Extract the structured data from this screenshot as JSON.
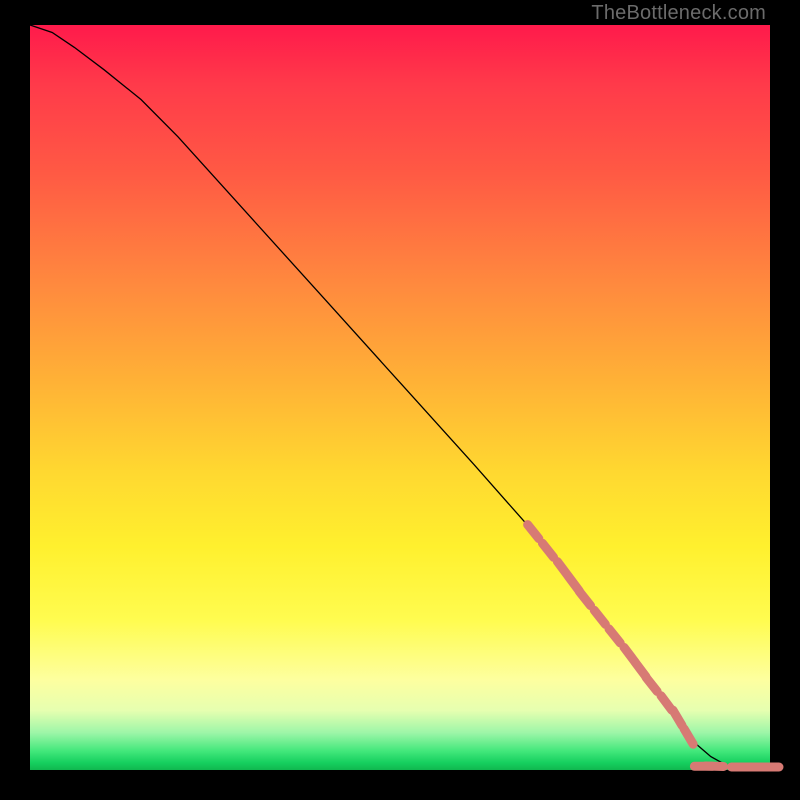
{
  "watermark": "TheBottleneck.com",
  "chart_data": {
    "type": "line",
    "title": "",
    "xlabel": "",
    "ylabel": "",
    "xlim": [
      0,
      100
    ],
    "ylim": [
      0,
      100
    ],
    "grid": false,
    "legend": false,
    "background_gradient": [
      "#ff1a4b",
      "#ff5a44",
      "#ffb236",
      "#fff02e",
      "#fdffa0",
      "#41e77a",
      "#10b74f"
    ],
    "series": [
      {
        "name": "curve",
        "color": "#000000",
        "stroke_width": 1.3,
        "x": [
          0,
          3,
          6,
          10,
          15,
          20,
          30,
          40,
          50,
          60,
          68,
          72,
          76,
          80,
          83,
          86,
          88,
          90,
          92,
          94,
          96,
          98,
          100
        ],
        "y": [
          100,
          99,
          97,
          94,
          90,
          85,
          74,
          63,
          52,
          41,
          32,
          27,
          22,
          17,
          13,
          9,
          6,
          3.5,
          1.8,
          0.7,
          0.1,
          0.05,
          0.05
        ]
      },
      {
        "name": "highlight-dots-diagonal",
        "color": "#d77a74",
        "marker": "circle",
        "marker_size": 9,
        "x": [
          68,
          70,
          72,
          73.5,
          75,
          77,
          79,
          81,
          82.5,
          84,
          86,
          87.5,
          89
        ],
        "y": [
          32,
          29.5,
          27,
          25,
          23,
          20.5,
          18,
          15.5,
          13.5,
          11.5,
          9,
          7,
          4.5
        ]
      },
      {
        "name": "highlight-dots-tail",
        "color": "#d77a74",
        "marker": "circle",
        "marker_size": 9,
        "x": [
          91,
          92.5,
          96,
          97.5,
          100
        ],
        "y": [
          0.5,
          0.5,
          0.4,
          0.4,
          0.4
        ]
      }
    ]
  }
}
